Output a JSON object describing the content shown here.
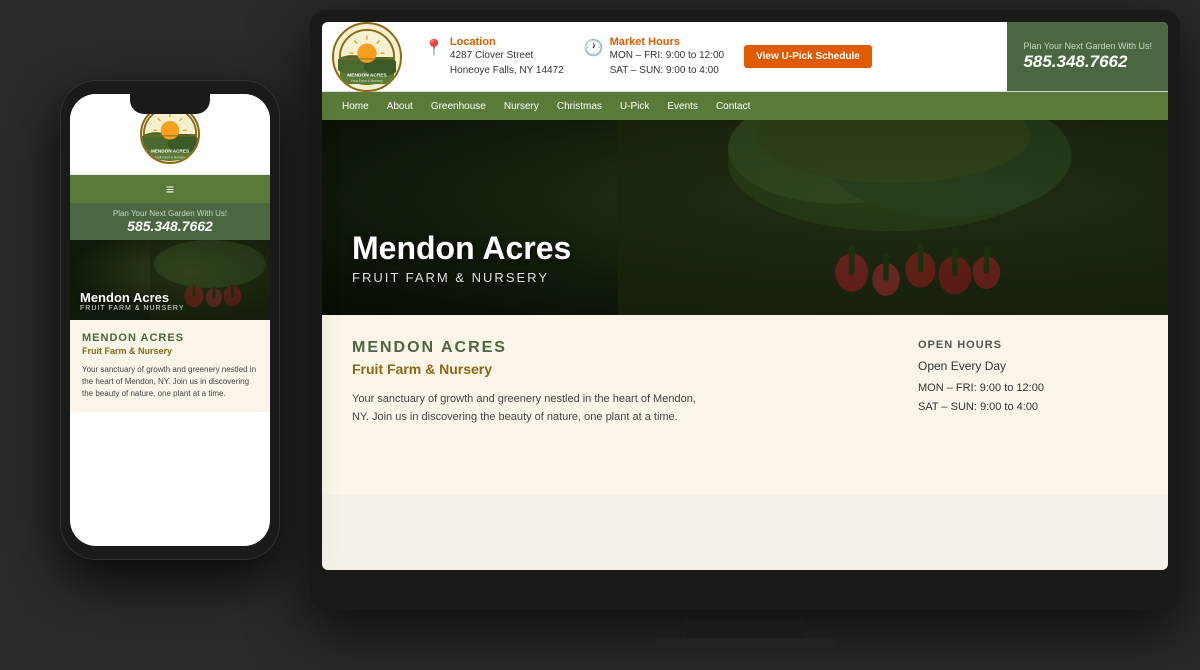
{
  "site": {
    "name": "Mendon Acres",
    "tagline": "Fruit Farm & Nursery",
    "tagline_upper": "FRUIT FARM & NURSERY",
    "name_upper": "MENDON ACRES",
    "description": "Your sanctuary of growth and greenery nestled in the heart of Mendon, NY. Join us in discovering the beauty of nature, one plant at a time.",
    "phone": "585.348.7662",
    "phone_plan": "Plan Your Next Garden With Us!"
  },
  "header": {
    "location_label": "Location",
    "address_line1": "4287 Clover Street",
    "address_line2": "Honeoye Falls, NY 14472",
    "hours_label": "Market Hours",
    "hours_weekday": "MON – FRI: 9:00 to 12:00",
    "hours_weekend": "SAT – SUN: 9:00 to 4:00",
    "upick_btn": "View U-Pick Schedule"
  },
  "nav": {
    "items": [
      "Home",
      "About",
      "Greenhouse",
      "Nursery",
      "Christmas",
      "U-Pick",
      "Events",
      "Contact"
    ]
  },
  "hero": {
    "title": "Mendon Acres",
    "subtitle": "FRUIT FARM & NURSERY"
  },
  "open_hours": {
    "section_title": "OPEN HOURS",
    "every_day": "Open Every Day",
    "weekday": "MON – FRI: 9:00 to 12:00",
    "weekend": "SAT – SUN: 9:00 to 4:00"
  },
  "colors": {
    "green_dark": "#4a6741",
    "green_nav": "#5a7a3a",
    "orange": "#e05a00",
    "cream": "#faf5e8",
    "gold": "#8b6914"
  }
}
